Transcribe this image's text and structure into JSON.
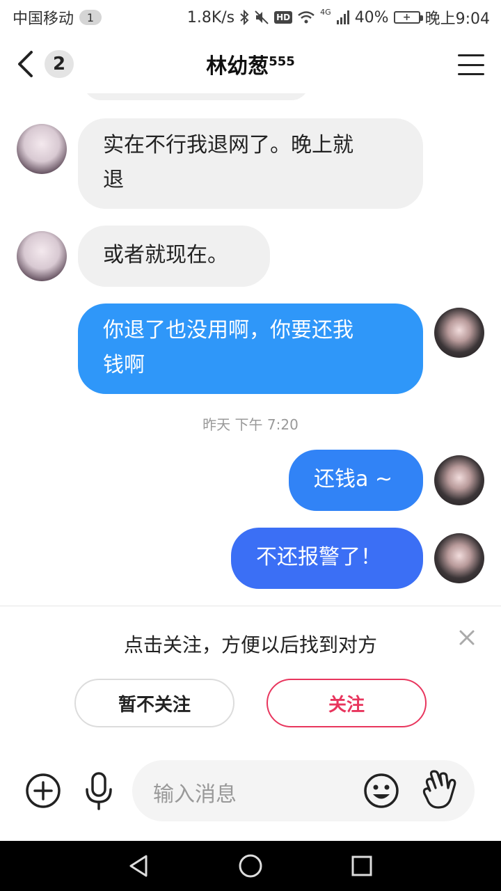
{
  "status_bar": {
    "carrier": "中国移动",
    "sim_badge": "1",
    "speed": "1.8K/s",
    "hd": "HD",
    "network": "4G",
    "battery": "40%",
    "time": "晚上9:04"
  },
  "header": {
    "unread_count": "2",
    "title": "林幼葱",
    "title_sup": "555"
  },
  "messages": [
    {
      "side": "in",
      "text_line1": "实在不行我退网了。晚上就",
      "text_line2": "退"
    },
    {
      "side": "in",
      "text_line1": "或者就现在。"
    },
    {
      "side": "out",
      "text_line1": "你退了也没用啊，你要还我",
      "text_line2": "钱啊"
    },
    {
      "type": "timestamp",
      "text": "昨天 下午 7:20"
    },
    {
      "side": "out",
      "text_line1": "还钱a ~"
    },
    {
      "side": "out",
      "text_line1": "不还报警了！"
    }
  ],
  "follow_prompt": {
    "text": "点击关注，方便以后找到对方",
    "skip_label": "暂不关注",
    "follow_label": "关注"
  },
  "input": {
    "placeholder": "输入消息"
  },
  "colors": {
    "bubble_in": "#f0f0f0",
    "bubble_out_top": "#2f8ff9",
    "bubble_out_bottom": "#3a6ff5",
    "follow_accent": "#e8355d"
  }
}
